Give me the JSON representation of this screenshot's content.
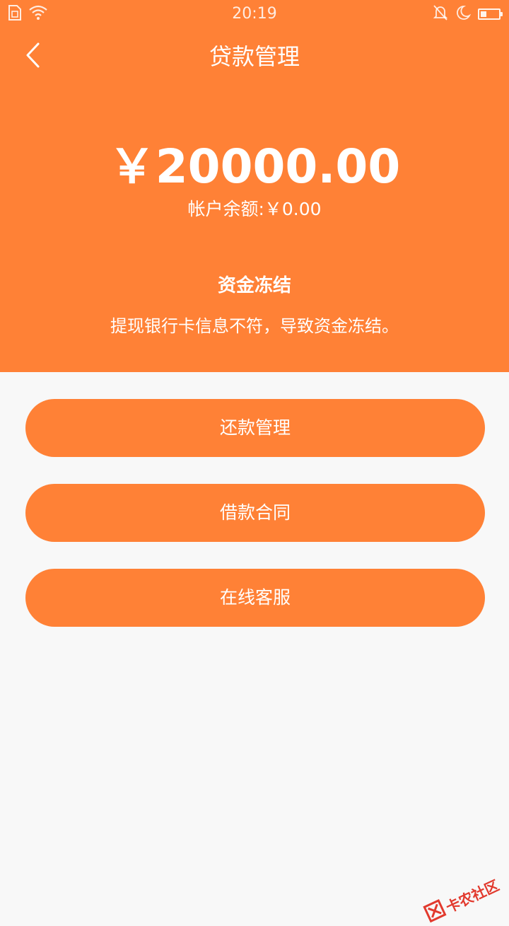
{
  "status_bar": {
    "time": "20:19",
    "battery_level": 0.35
  },
  "nav": {
    "title": "贷款管理"
  },
  "summary": {
    "amount": "￥20000.00",
    "balance_label": "帐户余额:",
    "balance_value": "￥0.00"
  },
  "notice": {
    "title": "资金冻结",
    "description": "提现银行卡信息不符，导致资金冻结。"
  },
  "menu": {
    "repayment_label": "还款管理",
    "contract_label": "借款合同",
    "service_label": "在线客服"
  },
  "watermark": {
    "text": "卡农社区"
  },
  "colors": {
    "brand": "#ff8136",
    "background": "#f8f8f8",
    "watermark": "#e23a2e"
  }
}
